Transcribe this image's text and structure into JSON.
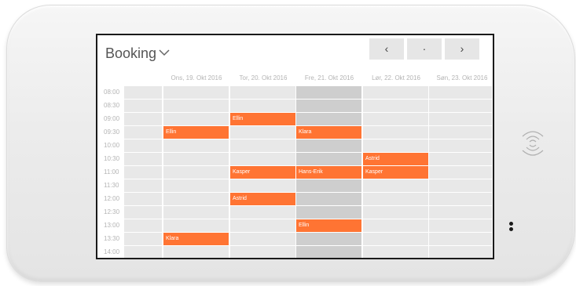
{
  "header": {
    "title": "Booking",
    "prev_label": "‹",
    "today_label": "·",
    "next_label": "›"
  },
  "days": [
    "Ons, 19. Okt 2016",
    "Tor, 20. Okt 2016",
    "Fre, 21. Okt 2016",
    "Lør, 22. Okt 2016",
    "Søn, 23. Okt 2016"
  ],
  "times": [
    "08:00",
    "08:30",
    "09:00",
    "09:30",
    "10:00",
    "10:30",
    "11:00",
    "11:30",
    "12:00",
    "12:30",
    "13:00",
    "13:30",
    "14:00"
  ],
  "highlighted_day": 2,
  "events": [
    {
      "day": 1,
      "slot": 2,
      "name": "Ellin"
    },
    {
      "day": 0,
      "slot": 3,
      "name": "Ellin"
    },
    {
      "day": 2,
      "slot": 3,
      "name": "Klara"
    },
    {
      "day": 3,
      "slot": 5,
      "name": "Astrid"
    },
    {
      "day": 1,
      "slot": 6,
      "name": "Kasper"
    },
    {
      "day": 2,
      "slot": 6,
      "name": "Hans-Erik"
    },
    {
      "day": 3,
      "slot": 6,
      "name": "Kasper"
    },
    {
      "day": 1,
      "slot": 8,
      "name": "Astrid"
    },
    {
      "day": 2,
      "slot": 10,
      "name": "Ellin"
    },
    {
      "day": 0,
      "slot": 11,
      "name": "Klara"
    }
  ],
  "colors": {
    "event": "#ff7433",
    "slot": "#e8e8e8",
    "slot_highlight": "#cecece"
  },
  "icons": {
    "dropdown": "chevron-down-icon",
    "nfc": "nfc-reader-icon"
  }
}
